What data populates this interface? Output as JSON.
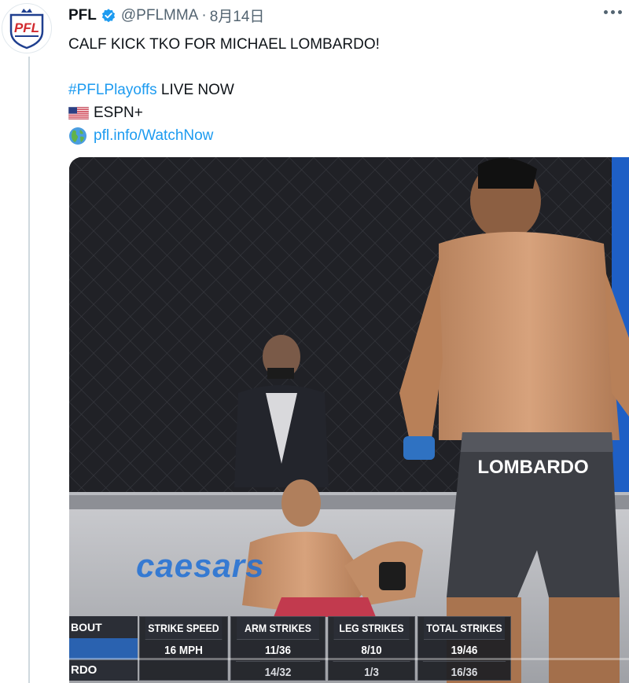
{
  "tweet": {
    "avatar_text": "PFL",
    "name": "PFL",
    "handle": "@PFLMMA",
    "separator": "·",
    "date": "8月14日",
    "text_line1": "CALF KICK TKO FOR MICHAEL LOMBARDO!",
    "hashtag": "#PFLPlayoffs",
    "live_text": " LIVE NOW",
    "network": "ESPN+",
    "link": "pfl.info/WatchNow",
    "colors": {
      "accent": "#1d9bf0",
      "brand_red": "#d12a2f",
      "brand_blue": "#1f3f8f"
    }
  },
  "video": {
    "shorts_name": "LOMBARDO",
    "brand_text": "caesars",
    "stats": {
      "bout_label": "BOUT",
      "fighter_label": "RDO",
      "strike_speed": {
        "label": "STRIKE SPEED",
        "value": "16 MPH"
      },
      "arm_strikes": {
        "label": "ARM STRIKES",
        "value1": "11/36",
        "value2": "14/32"
      },
      "leg_strikes": {
        "label": "LEG STRIKES",
        "value1": "8/10",
        "value2": "1/3"
      },
      "total_strikes": {
        "label": "TOTAL STRIKES",
        "value1": "19/46",
        "value2": "16/36"
      }
    }
  }
}
